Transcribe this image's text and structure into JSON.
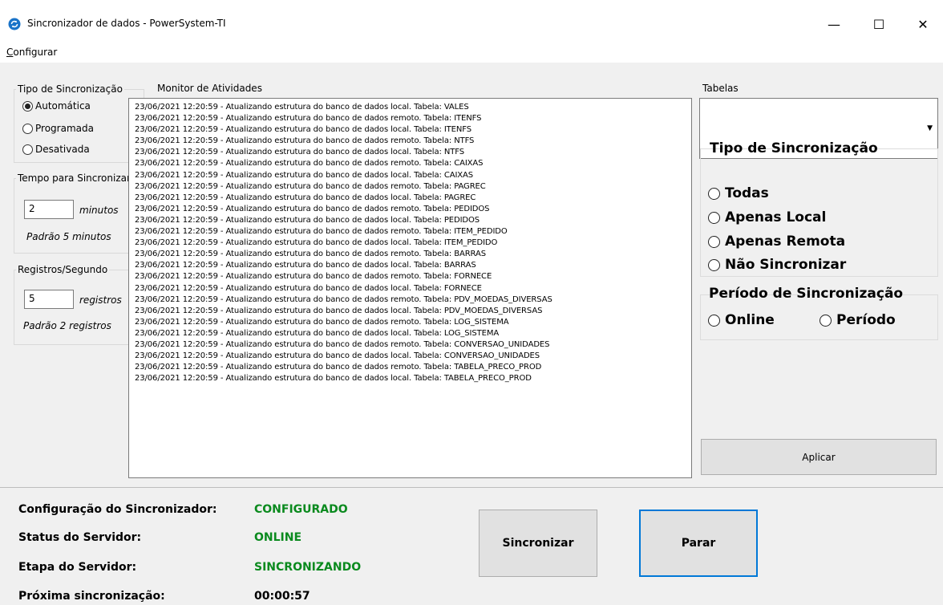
{
  "window": {
    "title": "Sincronizador de dados - PowerSystem-TI",
    "minimize_glyph": "—",
    "maximize_glyph": "☐",
    "close_glyph": "✕",
    "app_icon": "sync-icon",
    "accent_color": "#1a73c8"
  },
  "menu": {
    "items": [
      {
        "label": "Configurar",
        "accelerator": "C"
      }
    ]
  },
  "sync_type": {
    "group_label": "Tipo de Sincronização",
    "options": [
      {
        "label": "Automática",
        "selected": true
      },
      {
        "label": "Programada",
        "selected": false
      },
      {
        "label": "Desativada",
        "selected": false
      }
    ]
  },
  "sync_time": {
    "group_label": "Tempo para Sincronizar",
    "value": "2",
    "unit": "minutos",
    "hint": "Padrão 5 minutos"
  },
  "records": {
    "group_label": "Registros/Segundo",
    "value": "5",
    "unit": "registros",
    "hint": "Padrão 2 registros"
  },
  "monitor": {
    "group_label": "Monitor de Atividades",
    "lines": [
      "23/06/2021 12:20:59 - Atualizando estrutura do banco de dados local. Tabela: VALES",
      "23/06/2021 12:20:59 - Atualizando estrutura do banco de dados remoto. Tabela: ITENFS",
      "23/06/2021 12:20:59 - Atualizando estrutura do banco de dados local. Tabela: ITENFS",
      "23/06/2021 12:20:59 - Atualizando estrutura do banco de dados remoto. Tabela: NTFS",
      "23/06/2021 12:20:59 - Atualizando estrutura do banco de dados local. Tabela: NTFS",
      "23/06/2021 12:20:59 - Atualizando estrutura do banco de dados remoto. Tabela: CAIXAS",
      "23/06/2021 12:20:59 - Atualizando estrutura do banco de dados local. Tabela: CAIXAS",
      "23/06/2021 12:20:59 - Atualizando estrutura do banco de dados remoto. Tabela: PAGREC",
      "23/06/2021 12:20:59 - Atualizando estrutura do banco de dados local. Tabela: PAGREC",
      "23/06/2021 12:20:59 - Atualizando estrutura do banco de dados remoto. Tabela: PEDIDOS",
      "23/06/2021 12:20:59 - Atualizando estrutura do banco de dados local. Tabela: PEDIDOS",
      "23/06/2021 12:20:59 - Atualizando estrutura do banco de dados remoto. Tabela: ITEM_PEDIDO",
      "23/06/2021 12:20:59 - Atualizando estrutura do banco de dados local. Tabela: ITEM_PEDIDO",
      "23/06/2021 12:20:59 - Atualizando estrutura do banco de dados remoto. Tabela: BARRAS",
      "23/06/2021 12:20:59 - Atualizando estrutura do banco de dados local. Tabela: BARRAS",
      "23/06/2021 12:20:59 - Atualizando estrutura do banco de dados remoto. Tabela: FORNECE",
      "23/06/2021 12:20:59 - Atualizando estrutura do banco de dados local. Tabela: FORNECE",
      "23/06/2021 12:20:59 - Atualizando estrutura do banco de dados remoto. Tabela: PDV_MOEDAS_DIVERSAS",
      "23/06/2021 12:20:59 - Atualizando estrutura do banco de dados local. Tabela: PDV_MOEDAS_DIVERSAS",
      "23/06/2021 12:20:59 - Atualizando estrutura do banco de dados remoto. Tabela: LOG_SISTEMA",
      "23/06/2021 12:20:59 - Atualizando estrutura do banco de dados local. Tabela: LOG_SISTEMA",
      "23/06/2021 12:20:59 - Atualizando estrutura do banco de dados remoto. Tabela: CONVERSAO_UNIDADES",
      "23/06/2021 12:20:59 - Atualizando estrutura do banco de dados local. Tabela: CONVERSAO_UNIDADES",
      "23/06/2021 12:20:59 - Atualizando estrutura do banco de dados remoto. Tabela: TABELA_PRECO_PROD",
      "23/06/2021 12:20:59 - Atualizando estrutura do banco de dados local. Tabela: TABELA_PRECO_PROD"
    ]
  },
  "tables": {
    "group_label": "Tabelas",
    "selected_value": "",
    "dropdown_glyph": "▼",
    "table_sync_type": {
      "label": "Tipo de Sincronização",
      "options": [
        {
          "label": "Todas",
          "selected": false
        },
        {
          "label": "Apenas Local",
          "selected": false
        },
        {
          "label": "Apenas Remota",
          "selected": false
        },
        {
          "label": "Não Sincronizar",
          "selected": false
        }
      ]
    },
    "period": {
      "label": "Período de Sincronização",
      "options": [
        {
          "label": "Online",
          "selected": false
        },
        {
          "label": "Período",
          "selected": false
        }
      ]
    },
    "apply_label": "Aplicar"
  },
  "status": {
    "config_label": "Configuração do Sincronizador:",
    "config_value": "CONFIGURADO",
    "server_status_label": "Status do Servidor:",
    "server_status_value": "ONLINE",
    "server_stage_label": "Etapa do Servidor:",
    "server_stage_value": "SINCRONIZANDO",
    "next_sync_label": "Próxima sincronização:",
    "next_sync_value": "00:00:57",
    "ok_color": "#0a8a1e"
  },
  "actions": {
    "sync_label": "Sincronizar",
    "stop_label": "Parar"
  }
}
